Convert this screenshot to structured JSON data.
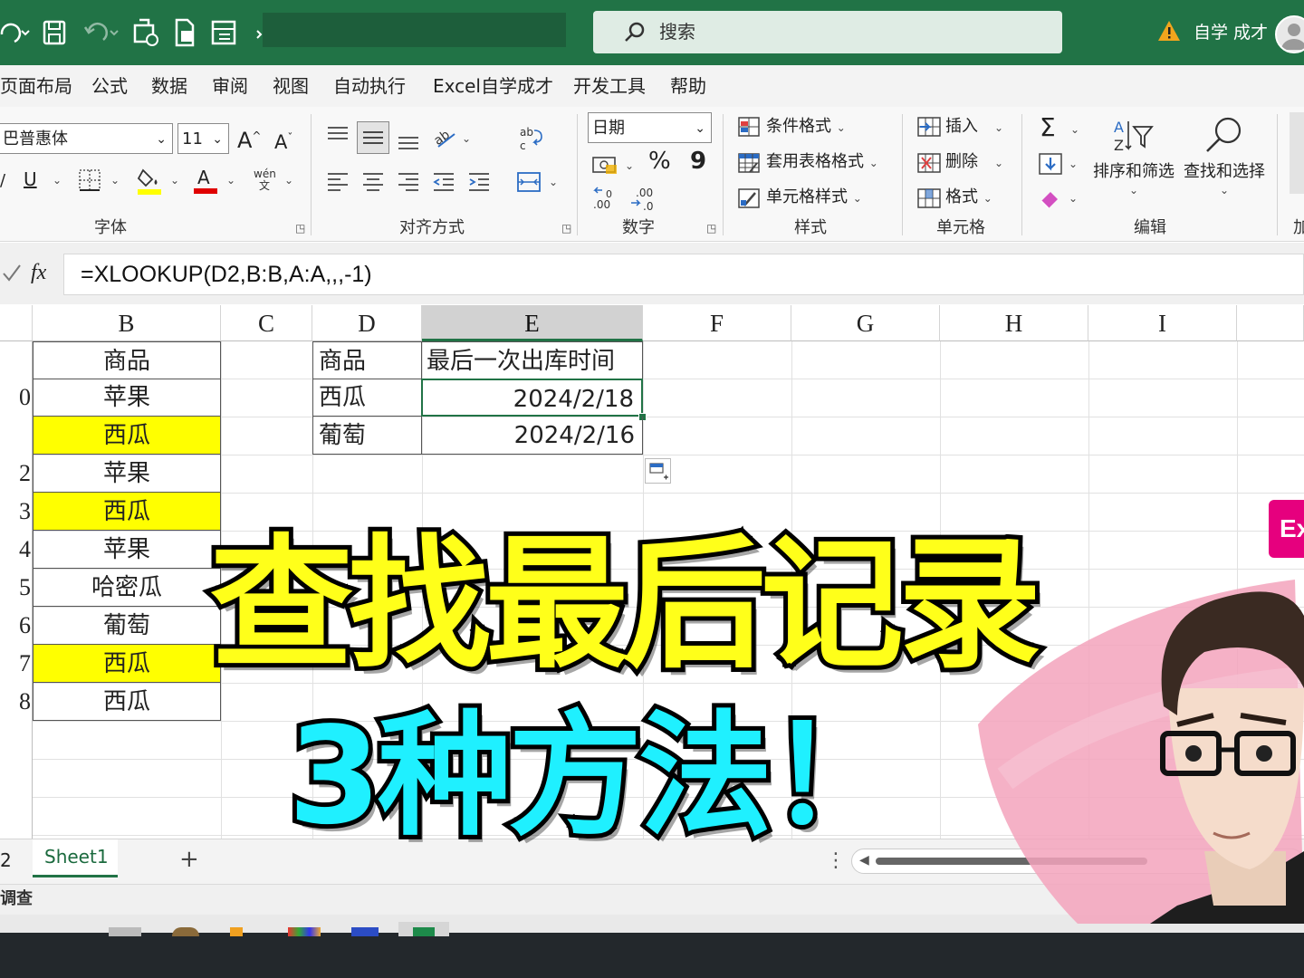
{
  "colors": {
    "brand_green": "#217346",
    "highlight_yellow": "#ffff00",
    "title_yellow": "#ffff1a",
    "title_cyan": "#1ff0ff",
    "badge_pink": "#e6007e"
  },
  "titlebar": {
    "search_placeholder": "搜索",
    "user_name": "自学 成才"
  },
  "menu": {
    "tabs": [
      "页面布局",
      "公式",
      "数据",
      "审阅",
      "视图",
      "自动执行",
      "Excel自学成才",
      "开发工具",
      "帮助"
    ]
  },
  "ribbon": {
    "font": {
      "font_name": "巴普惠体",
      "font_size": "11",
      "increase_label": "A",
      "decrease_label": "A",
      "underline_label": "U",
      "font_color_label": "A",
      "phonetic_label": "wén",
      "phonetic_sub": "文",
      "group_label": "字体"
    },
    "alignment": {
      "group_label": "对齐方式"
    },
    "number": {
      "format_value": "日期",
      "percent": "%",
      "comma": "9",
      "group_label": "数字"
    },
    "styles": {
      "conditional": "条件格式",
      "table_format": "套用表格格式",
      "cell_styles": "单元格样式",
      "group_label": "样式"
    },
    "cells": {
      "insert": "插入",
      "delete": "删除",
      "format": "格式",
      "group_label": "单元格"
    },
    "editing": {
      "sort_filter": "排序和筛选",
      "find_select": "查找和选择",
      "group_label": "编辑"
    },
    "partial_group_label": "加"
  },
  "formula_bar": {
    "fx": "fx",
    "formula": "=XLOOKUP(D2,B:B,A:A,,,-1)"
  },
  "grid": {
    "columns": [
      "B",
      "C",
      "D",
      "E",
      "F",
      "G",
      "H",
      "I"
    ],
    "row_headers": [
      "",
      "0",
      "",
      "2",
      "3",
      "4",
      "5",
      "6",
      "7",
      "8"
    ],
    "column_b": [
      {
        "text": "商品",
        "highlight": false
      },
      {
        "text": "苹果",
        "highlight": false
      },
      {
        "text": "西瓜",
        "highlight": true
      },
      {
        "text": "苹果",
        "highlight": false
      },
      {
        "text": "西瓜",
        "highlight": true
      },
      {
        "text": "苹果",
        "highlight": false
      },
      {
        "text": "哈密瓜",
        "highlight": false
      },
      {
        "text": "葡萄",
        "highlight": false
      },
      {
        "text": "西瓜",
        "highlight": true
      },
      {
        "text": "西瓜",
        "highlight": false
      }
    ],
    "lookup_table": {
      "header_product": "商品",
      "header_time": "最后一次出库时间",
      "rows": [
        {
          "product": "西瓜",
          "time": "2024/2/18"
        },
        {
          "product": "葡萄",
          "time": "2024/2/16"
        }
      ]
    }
  },
  "sheets": {
    "partial_tab": "2",
    "active_tab": "Sheet1",
    "add_label": "+"
  },
  "status": {
    "text": "调查"
  },
  "overlay": {
    "line1": "查找最后记录",
    "line2": "3种方法！",
    "badge": "Ex"
  }
}
